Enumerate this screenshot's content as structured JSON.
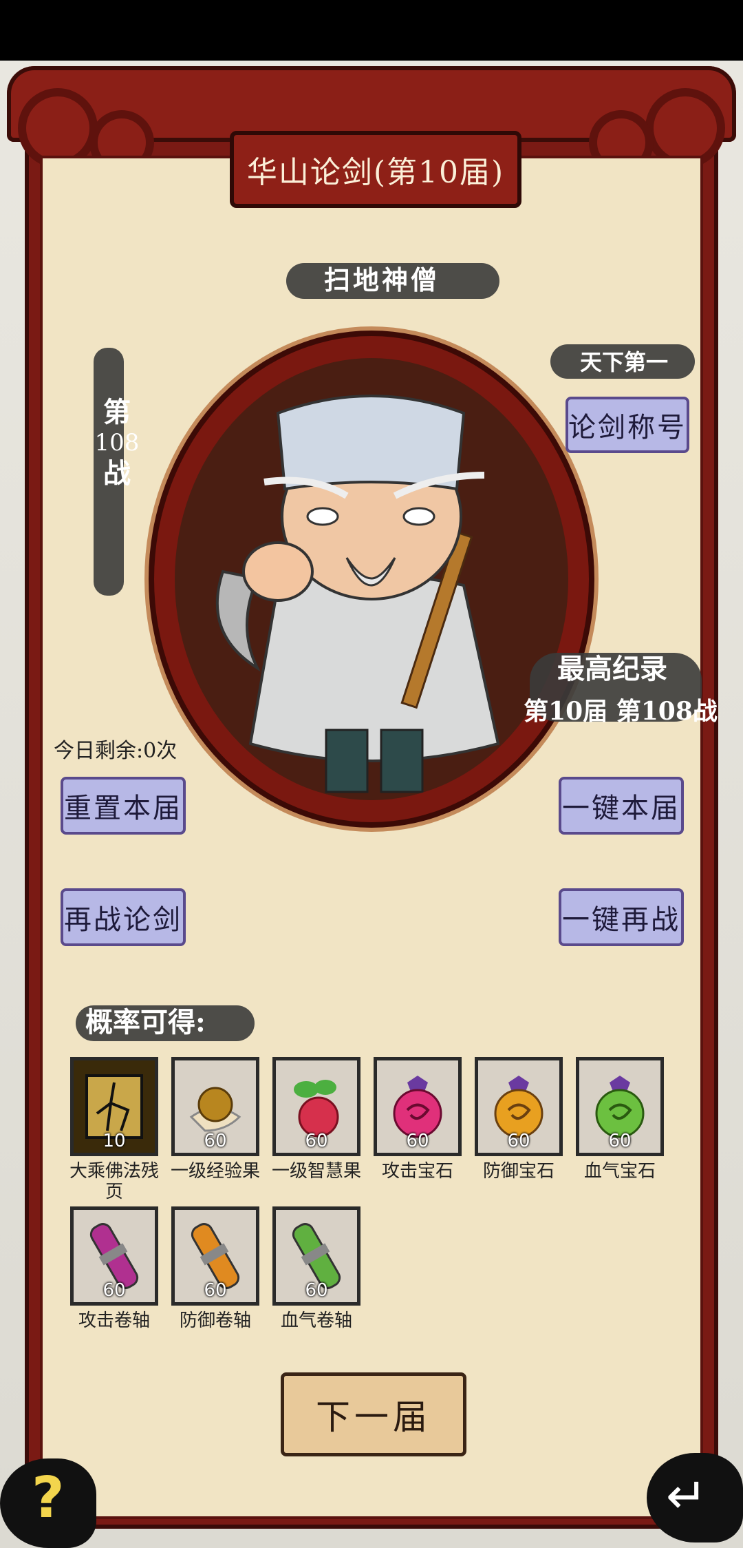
{
  "header": {
    "title": "华山论剑(第10届)"
  },
  "opponent": {
    "name": "扫地神僧"
  },
  "battle": {
    "prefix": "第",
    "number": "108",
    "suffix": "战"
  },
  "honor": {
    "rank_tag": "天下第一",
    "title_button": "论剑称号"
  },
  "record": {
    "label": "最高纪录",
    "value": "第10届 第108战"
  },
  "remaining": {
    "text": "今日剩余:0次"
  },
  "actions": {
    "reset": "重置本届",
    "one_click_current": "一键本届",
    "rechallenge": "再战论剑",
    "one_click_again": "一键再战"
  },
  "rewards": {
    "label": "概率可得:",
    "items": [
      {
        "name": "大乘佛法残页",
        "count": "10",
        "icon": "cracked-scroll-icon"
      },
      {
        "name": "一级经验果",
        "count": "60",
        "icon": "exp-fruit-icon"
      },
      {
        "name": "一级智慧果",
        "count": "60",
        "icon": "wisdom-fruit-icon"
      },
      {
        "name": "攻击宝石",
        "count": "60",
        "icon": "attack-gem-icon",
        "color": "#e0307a"
      },
      {
        "name": "防御宝石",
        "count": "60",
        "icon": "defense-gem-icon",
        "color": "#e8a020"
      },
      {
        "name": "血气宝石",
        "count": "60",
        "icon": "vitality-gem-icon",
        "color": "#6cc040"
      },
      {
        "name": "攻击卷轴",
        "count": "60",
        "icon": "attack-scroll-icon",
        "color": "#b03090"
      },
      {
        "name": "防御卷轴",
        "count": "60",
        "icon": "defense-scroll-icon",
        "color": "#e08a20"
      },
      {
        "name": "血气卷轴",
        "count": "60",
        "icon": "vitality-scroll-icon",
        "color": "#60b040"
      }
    ]
  },
  "footer": {
    "next_button": "下一届",
    "help_glyph": "?",
    "back_glyph": "↵"
  }
}
